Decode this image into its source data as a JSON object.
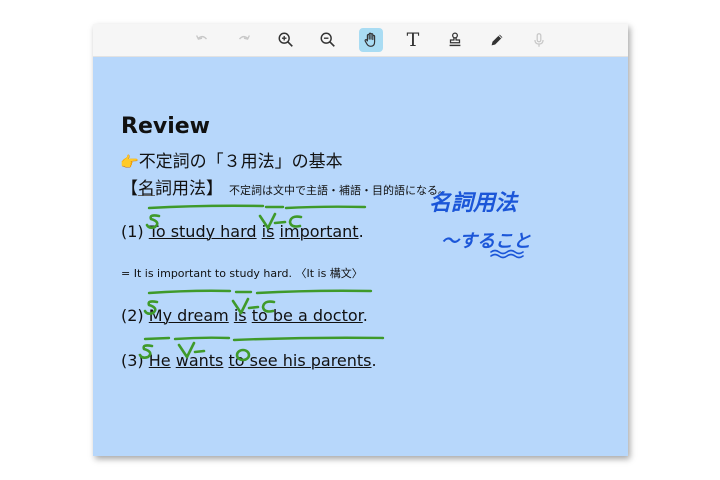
{
  "toolbar": {
    "tools": [
      {
        "name": "undo",
        "icon": "undo-icon",
        "enabled": false
      },
      {
        "name": "redo",
        "icon": "redo-icon",
        "enabled": false
      },
      {
        "name": "zoom-in",
        "icon": "zoom-in-icon",
        "enabled": true
      },
      {
        "name": "zoom-out",
        "icon": "zoom-out-icon",
        "enabled": true
      },
      {
        "name": "hand",
        "icon": "hand-icon",
        "enabled": true,
        "active": true
      },
      {
        "name": "text",
        "icon": "text-icon",
        "label": "T",
        "enabled": true
      },
      {
        "name": "stamp",
        "icon": "stamp-icon",
        "enabled": true
      },
      {
        "name": "pen",
        "icon": "pen-icon",
        "enabled": true
      },
      {
        "name": "microphone",
        "icon": "microphone-icon",
        "enabled": false
      }
    ],
    "active_color": "#a9dcf3"
  },
  "note": {
    "title": "Review",
    "subtitle_icon": "pointing-hand-icon",
    "subtitle": "不定詞の「３用法」の基本",
    "section_open": "【",
    "section_mei": "名",
    "section_rest": "詞用法",
    "section_close": "】",
    "section_note": "不定詞は文中で主語・補語・目的語になる。",
    "sentence1": {
      "num": "(1)",
      "p1": "To study hard",
      "p2": "is",
      "p3": "important",
      "end": "."
    },
    "rewrite": "= It is important to study hard. 〈It is 構文〉",
    "sentence2": {
      "num": "(2)",
      "p1": "My dream",
      "p2": "is",
      "p3": "to be a doctor",
      "end": "."
    },
    "sentence3": {
      "num": "(3)",
      "p1": "He",
      "p2": "wants",
      "p3": "to see his parents",
      "end": "."
    }
  },
  "colors": {
    "background": "#b7d7fb",
    "ink_green": "#3f9a2a",
    "ink_blue": "#1b56d8"
  },
  "handwriting": {
    "heading": "名詞用法",
    "meaning": "〜すること",
    "labels_s1": [
      "S",
      "V",
      "C"
    ],
    "labels_s2": [
      "S",
      "V",
      "C"
    ],
    "labels_s3": [
      "S",
      "V",
      "O"
    ]
  }
}
